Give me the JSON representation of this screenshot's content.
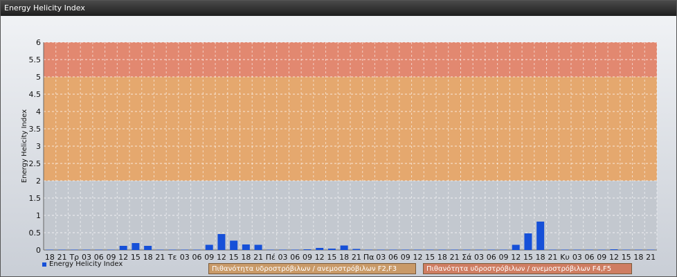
{
  "window": {
    "title": "Energy Helicity Index"
  },
  "legend": {
    "label": "Energy Helicity Index"
  },
  "bands": [
    {
      "label": "Πιθανότητα υδροστρόβιλων / ανεμοστρόβιλων F2,F3",
      "from": 2,
      "to": 5,
      "color": "#e5a86e"
    },
    {
      "label": "Πιθανότητα υδροστρόβιλων / ανεμοστρόβιλων F4,F5",
      "from": 5,
      "to": 6,
      "color": "#e28870"
    }
  ],
  "chart_data": {
    "type": "bar",
    "title": "",
    "xlabel": "",
    "ylabel": "Energy Helicity Index",
    "ylim": [
      0,
      6
    ],
    "yticks": [
      "0",
      "0.5",
      "1",
      "1.5",
      "2",
      "2.5",
      "3",
      "3.5",
      "4",
      "4.5",
      "5",
      "5.5",
      "6"
    ],
    "grid": true,
    "legend_position": "bottom-left",
    "bar_color": "#1650d8",
    "categories": [
      "18",
      "21",
      "Τρ",
      "03",
      "06",
      "09",
      "12",
      "15",
      "18",
      "21",
      "Τε",
      "03",
      "06",
      "09",
      "12",
      "15",
      "18",
      "21",
      "Πέ",
      "03",
      "06",
      "09",
      "12",
      "15",
      "18",
      "21",
      "Πα",
      "03",
      "06",
      "09",
      "12",
      "15",
      "18",
      "21",
      "Σά",
      "03",
      "06",
      "09",
      "12",
      "15",
      "18",
      "21",
      "Κυ",
      "03",
      "06",
      "09",
      "12",
      "15",
      "18",
      "21"
    ],
    "series": [
      {
        "name": "Energy Helicity Index",
        "values": [
          0.01,
          0.01,
          0.01,
          0.01,
          0.01,
          0.01,
          0.12,
          0.2,
          0.12,
          0.01,
          0.01,
          0.01,
          0.01,
          0.15,
          0.46,
          0.27,
          0.16,
          0.15,
          0.01,
          0.01,
          0.01,
          0.02,
          0.06,
          0.04,
          0.13,
          0.03,
          0.01,
          0.01,
          0.01,
          0.01,
          0.01,
          0.01,
          0.01,
          0.01,
          0.01,
          0.01,
          0.01,
          0.01,
          0.15,
          0.48,
          0.82,
          0.01,
          0.01,
          0.01,
          0.01,
          0.01,
          0.02,
          0.01,
          0.01,
          0.01
        ]
      }
    ]
  }
}
